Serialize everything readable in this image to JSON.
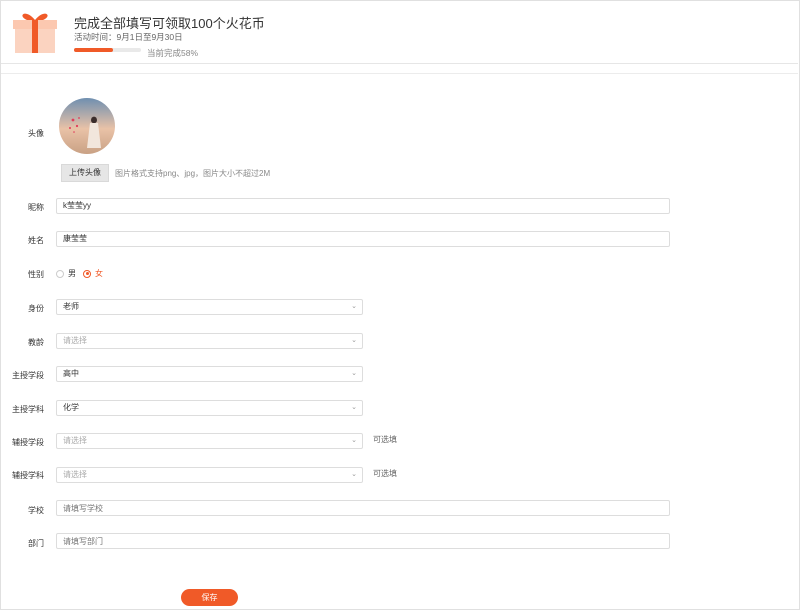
{
  "banner": {
    "title": "完成全部填写可领取100个火花币",
    "subtitle": "活动时间：9月1日至9月30日",
    "progress": 0.58,
    "progress_text": "当前完成58%"
  },
  "colors": {
    "accent": "#f05a28"
  },
  "avatar": {
    "label": "头像",
    "upload_label": "上传头像",
    "hint": "图片格式支持png、jpg，图片大小不超过2M"
  },
  "fields": {
    "nickname": {
      "label": "昵称",
      "value": "k莹莹yy"
    },
    "name": {
      "label": "姓名",
      "value": "康莹莹"
    },
    "gender": {
      "label": "性别",
      "options": [
        "男",
        "女"
      ],
      "selected": "女"
    },
    "identity": {
      "label": "身份",
      "value": "老师"
    },
    "teaching_age": {
      "label": "教龄",
      "placeholder": "请选择"
    },
    "main_stage": {
      "label": "主授学段",
      "value": "高中"
    },
    "main_subject": {
      "label": "主授学科",
      "value": "化学"
    },
    "aux_stage": {
      "label": "辅授学段",
      "placeholder": "请选择",
      "note": "可选填"
    },
    "aux_subject": {
      "label": "辅授学科",
      "placeholder": "请选择",
      "note": "可选填"
    },
    "school": {
      "label": "学校",
      "placeholder": "请填写学校"
    },
    "department": {
      "label": "部门",
      "placeholder": "请填写部门"
    }
  },
  "save_label": "保存"
}
